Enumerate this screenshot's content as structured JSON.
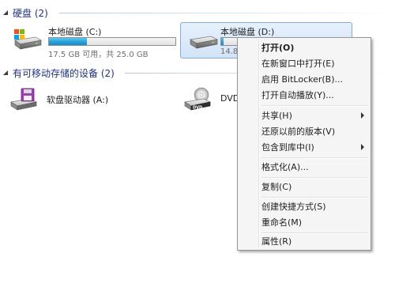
{
  "groups": {
    "hard_disks": {
      "title": "硬盘 (2)"
    },
    "removable": {
      "title": "有可移动存储的设备 (2)"
    }
  },
  "drives": [
    {
      "name": "本地磁盘 (C:)",
      "space_text": "17.5 GB 可用，共 25.0 GB",
      "used_fraction": 0.3,
      "icon": "windows-drive-icon"
    },
    {
      "name": "本地磁盘 (D:)",
      "space_text": "14.8",
      "used_fraction": 0.02,
      "icon": "hard-drive-icon",
      "selected": true
    }
  ],
  "devices": [
    {
      "name": "软盘驱动器 (A:)",
      "icon": "floppy-drive-icon"
    },
    {
      "name": "DVD",
      "icon": "dvd-drive-icon"
    }
  ],
  "context_menu": {
    "items": [
      {
        "label": "打开(O)",
        "bold": true
      },
      {
        "label": "在新窗口中打开(E)"
      },
      {
        "label": "启用 BitLocker(B)..."
      },
      {
        "label": "打开自动播放(Y)..."
      },
      {
        "label": "共享(H)",
        "submenu": true
      },
      {
        "label": "还原以前的版本(V)"
      },
      {
        "label": "包含到库中(I)",
        "submenu": true
      },
      {
        "label": "格式化(A)..."
      },
      {
        "label": "复制(C)"
      },
      {
        "label": "创建快捷方式(S)"
      },
      {
        "label": "重命名(M)"
      },
      {
        "label": "属性(R)"
      }
    ]
  },
  "colors": {
    "group_title": "#1e3287",
    "selection_fill": "#d2e4f8",
    "selection_border": "#84acdd",
    "capacity_fill": "#26a0da",
    "menu_background": "#f5f5f5"
  }
}
